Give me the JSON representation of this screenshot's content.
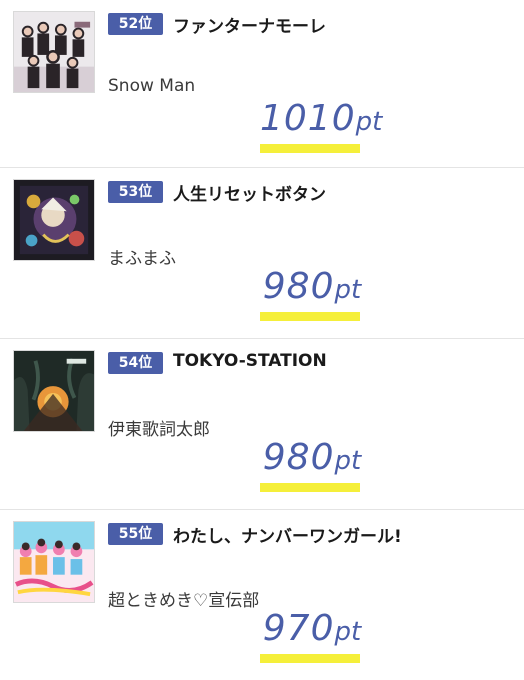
{
  "entries": [
    {
      "rank": "52位",
      "title": "ファンターナモーレ",
      "artist": "Snow Man",
      "points_value": "1010",
      "points_unit": "pt",
      "cover": "group-photo-cover"
    },
    {
      "rank": "53位",
      "title": "人生リセットボタン",
      "artist": "まふまふ",
      "points_value": "980",
      "points_unit": "pt",
      "cover": "anime-illustration-cover"
    },
    {
      "rank": "54位",
      "title": "TOKYO-STATION",
      "artist": "伊東歌詞太郎",
      "points_value": "980",
      "points_unit": "pt",
      "cover": "sunset-forest-cover"
    },
    {
      "rank": "55位",
      "title": "わたし、ナンバーワンガール!",
      "artist": "超ときめき♡宣伝部",
      "points_value": "970",
      "points_unit": "pt",
      "cover": "idol-group-cover"
    }
  ],
  "colors": {
    "badge": "#4a5ea8",
    "points": "#4a5ea8",
    "highlight": "#f5ef3a"
  }
}
